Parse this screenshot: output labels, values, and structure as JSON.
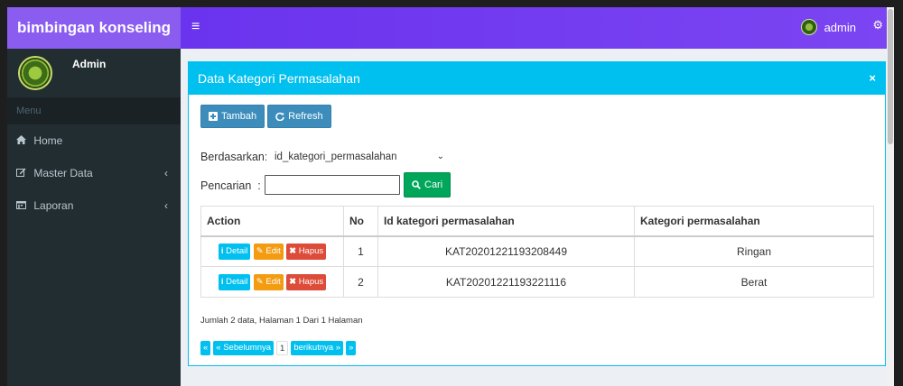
{
  "app": {
    "logo": "bimbingan konseling"
  },
  "topbar": {
    "toggle_icon": "≡",
    "user_name": "admin",
    "gears_icon": "⚙"
  },
  "sidebar": {
    "user_name": "Admin",
    "menu_header": "Menu",
    "items": [
      {
        "icon": "home-icon",
        "label": "Home",
        "has_caret": false
      },
      {
        "icon": "edit-icon",
        "label": "Master Data",
        "has_caret": true
      },
      {
        "icon": "calendar-icon",
        "label": "Laporan",
        "has_caret": true
      }
    ]
  },
  "box": {
    "title": "Data Kategori Permasalahan",
    "close": "×",
    "add_label": "Tambah",
    "refresh_label": "Refresh",
    "filter_label": "Berdasarkan:",
    "filter_value": "id_kategori_permasalahan",
    "search_label": "Pencarian  :",
    "search_value": "",
    "search_button": "Cari"
  },
  "table": {
    "headers": [
      "Action",
      "No",
      "Id kategori permasalahan",
      "Kategori permasalahan"
    ],
    "action_labels": {
      "detail": "Detail",
      "edit": "Edit",
      "hapus": "Hapus"
    },
    "rows": [
      {
        "no": "1",
        "id": "KAT20201221193208449",
        "kategori": "Ringan"
      },
      {
        "no": "2",
        "id": "KAT20201221193221116",
        "kategori": "Berat"
      }
    ]
  },
  "pagination": {
    "info": "Jumlah 2 data, Halaman 1 Dari 1 Halaman",
    "first": "«",
    "prev": "« Sebelumnya",
    "current": "1",
    "next": "berikutnya »",
    "last": "»"
  },
  "colors": {
    "accent": "#00c0ef",
    "topbar": "#6a33ee",
    "sidebar": "#222d32"
  }
}
